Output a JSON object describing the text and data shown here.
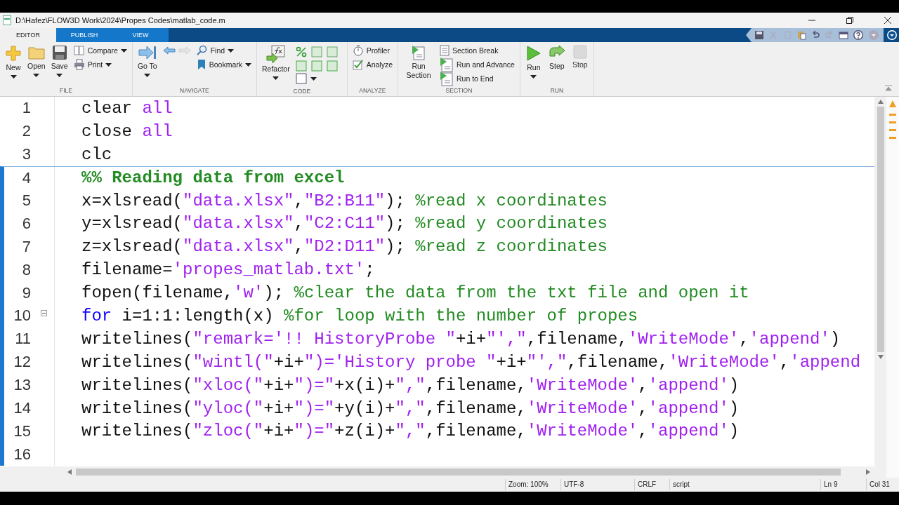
{
  "window": {
    "title": "D:\\Hafez\\FLOW3D Work\\2024\\Propes Codes\\matlab_code.m"
  },
  "tabs": [
    {
      "label": "EDITOR",
      "selected": true
    },
    {
      "label": "PUBLISH",
      "selected": false
    },
    {
      "label": "VIEW",
      "selected": false
    }
  ],
  "toolstrip": [
    {
      "label": "FILE",
      "big": [
        {
          "label": "New",
          "dropdown": true
        },
        {
          "label": "Open",
          "dropdown": true
        },
        {
          "label": "Save",
          "dropdown": true
        }
      ],
      "small": [
        {
          "label": "Compare",
          "dropdown": true
        },
        {
          "label": "Print",
          "dropdown": true
        }
      ]
    },
    {
      "label": "NAVIGATE",
      "big": [
        {
          "label": "Go To",
          "dropdown": true
        }
      ],
      "small": [
        {
          "label": "Find",
          "dropdown": true
        },
        {
          "label": "Bookmark",
          "dropdown": true
        }
      ]
    },
    {
      "label": "CODE",
      "big": [
        {
          "label": "Refactor",
          "dropdown": true
        }
      ]
    },
    {
      "label": "ANALYZE",
      "small": [
        {
          "label": "Profiler",
          "dropdown": false
        },
        {
          "label": "Analyze",
          "dropdown": false
        }
      ]
    },
    {
      "label": "SECTION",
      "big": [
        {
          "label": "Run Section",
          "dropdown": false
        }
      ],
      "small": [
        {
          "label": "Section Break",
          "dropdown": false
        },
        {
          "label": "Run and Advance",
          "dropdown": false
        },
        {
          "label": "Run to End",
          "dropdown": false
        }
      ]
    },
    {
      "label": "RUN",
      "big": [
        {
          "label": "Run",
          "dropdown": true,
          "disabled": false
        },
        {
          "label": "Step",
          "dropdown": false,
          "disabled": false
        },
        {
          "label": "Stop",
          "dropdown": false,
          "disabled": true
        }
      ]
    }
  ],
  "editor": {
    "lines": [
      {
        "number": "1",
        "section_start": false,
        "foldable": false,
        "segments": [
          {
            "kind": "plain",
            "text": "clear "
          },
          {
            "kind": "string",
            "text": "all"
          }
        ]
      },
      {
        "number": "2",
        "section_start": false,
        "foldable": false,
        "segments": [
          {
            "kind": "plain",
            "text": "close "
          },
          {
            "kind": "string",
            "text": "all"
          }
        ]
      },
      {
        "number": "3",
        "section_start": false,
        "foldable": false,
        "segments": [
          {
            "kind": "plain",
            "text": "clc"
          }
        ]
      },
      {
        "number": "4",
        "section_start": true,
        "foldable": false,
        "segments": [
          {
            "kind": "section",
            "text": "%% Reading data from excel"
          }
        ]
      },
      {
        "number": "5",
        "section_start": false,
        "foldable": false,
        "segments": [
          {
            "kind": "plain",
            "text": "x=xlsread("
          },
          {
            "kind": "string",
            "text": "\"data.xlsx\""
          },
          {
            "kind": "plain",
            "text": ","
          },
          {
            "kind": "string",
            "text": "\"B2:B11\""
          },
          {
            "kind": "plain",
            "text": "); "
          },
          {
            "kind": "comment",
            "text": "%read x coordinates"
          }
        ]
      },
      {
        "number": "6",
        "section_start": false,
        "foldable": false,
        "segments": [
          {
            "kind": "plain",
            "text": "y=xlsread("
          },
          {
            "kind": "string",
            "text": "\"data.xlsx\""
          },
          {
            "kind": "plain",
            "text": ","
          },
          {
            "kind": "string",
            "text": "\"C2:C11\""
          },
          {
            "kind": "plain",
            "text": "); "
          },
          {
            "kind": "comment",
            "text": "%read y coordinates"
          }
        ]
      },
      {
        "number": "7",
        "section_start": false,
        "foldable": false,
        "segments": [
          {
            "kind": "plain",
            "text": "z=xlsread("
          },
          {
            "kind": "string",
            "text": "\"data.xlsx\""
          },
          {
            "kind": "plain",
            "text": ","
          },
          {
            "kind": "string",
            "text": "\"D2:D11\""
          },
          {
            "kind": "plain",
            "text": "); "
          },
          {
            "kind": "comment",
            "text": "%read z coordinates"
          }
        ]
      },
      {
        "number": "8",
        "section_start": false,
        "foldable": false,
        "segments": [
          {
            "kind": "plain",
            "text": "filename="
          },
          {
            "kind": "string",
            "text": "'propes_matlab.txt'"
          },
          {
            "kind": "plain",
            "text": ";"
          }
        ]
      },
      {
        "number": "9",
        "section_start": false,
        "foldable": false,
        "segments": [
          {
            "kind": "plain",
            "text": "fopen(filename,"
          },
          {
            "kind": "string",
            "text": "'w'"
          },
          {
            "kind": "plain",
            "text": "); "
          },
          {
            "kind": "comment",
            "text": "%clear the data from the txt file and open it"
          }
        ]
      },
      {
        "number": "10",
        "section_start": false,
        "foldable": true,
        "segments": [
          {
            "kind": "keyword",
            "text": "for"
          },
          {
            "kind": "plain",
            "text": " i=1:1:length(x) "
          },
          {
            "kind": "comment",
            "text": "%for loop with the number of propes"
          }
        ]
      },
      {
        "number": "11",
        "section_start": false,
        "foldable": false,
        "segments": [
          {
            "kind": "plain",
            "text": "writelines("
          },
          {
            "kind": "string",
            "text": "\"remark='!! HistoryProbe \""
          },
          {
            "kind": "plain",
            "text": "+i+"
          },
          {
            "kind": "string",
            "text": "\"',\""
          },
          {
            "kind": "plain",
            "text": ",filename,"
          },
          {
            "kind": "string",
            "text": "'WriteMode'"
          },
          {
            "kind": "plain",
            "text": ","
          },
          {
            "kind": "string",
            "text": "'append'"
          },
          {
            "kind": "plain",
            "text": ")"
          }
        ]
      },
      {
        "number": "12",
        "section_start": false,
        "foldable": false,
        "segments": [
          {
            "kind": "plain",
            "text": "writelines("
          },
          {
            "kind": "string",
            "text": "\"wintl(\""
          },
          {
            "kind": "plain",
            "text": "+i+"
          },
          {
            "kind": "string",
            "text": "\")='History probe \""
          },
          {
            "kind": "plain",
            "text": "+i+"
          },
          {
            "kind": "string",
            "text": "\"',\""
          },
          {
            "kind": "plain",
            "text": ",filename,"
          },
          {
            "kind": "string",
            "text": "'WriteMode'"
          },
          {
            "kind": "plain",
            "text": ","
          },
          {
            "kind": "string",
            "text": "'append"
          }
        ]
      },
      {
        "number": "13",
        "section_start": false,
        "foldable": false,
        "segments": [
          {
            "kind": "plain",
            "text": "writelines("
          },
          {
            "kind": "string",
            "text": "\"xloc(\""
          },
          {
            "kind": "plain",
            "text": "+i+"
          },
          {
            "kind": "string",
            "text": "\")=\""
          },
          {
            "kind": "plain",
            "text": "+x(i)+"
          },
          {
            "kind": "string",
            "text": "\",\""
          },
          {
            "kind": "plain",
            "text": ",filename,"
          },
          {
            "kind": "string",
            "text": "'WriteMode'"
          },
          {
            "kind": "plain",
            "text": ","
          },
          {
            "kind": "string",
            "text": "'append'"
          },
          {
            "kind": "plain",
            "text": ")"
          }
        ]
      },
      {
        "number": "14",
        "section_start": false,
        "foldable": false,
        "segments": [
          {
            "kind": "plain",
            "text": "writelines("
          },
          {
            "kind": "string",
            "text": "\"yloc(\""
          },
          {
            "kind": "plain",
            "text": "+i+"
          },
          {
            "kind": "string",
            "text": "\")=\""
          },
          {
            "kind": "plain",
            "text": "+y(i)+"
          },
          {
            "kind": "string",
            "text": "\",\""
          },
          {
            "kind": "plain",
            "text": ",filename,"
          },
          {
            "kind": "string",
            "text": "'WriteMode'"
          },
          {
            "kind": "plain",
            "text": ","
          },
          {
            "kind": "string",
            "text": "'append'"
          },
          {
            "kind": "plain",
            "text": ")"
          }
        ]
      },
      {
        "number": "15",
        "section_start": false,
        "foldable": false,
        "segments": [
          {
            "kind": "plain",
            "text": "writelines("
          },
          {
            "kind": "string",
            "text": "\"zloc(\""
          },
          {
            "kind": "plain",
            "text": "+i+"
          },
          {
            "kind": "string",
            "text": "\")=\""
          },
          {
            "kind": "plain",
            "text": "+z(i)+"
          },
          {
            "kind": "string",
            "text": "\",\""
          },
          {
            "kind": "plain",
            "text": ",filename,"
          },
          {
            "kind": "string",
            "text": "'WriteMode'"
          },
          {
            "kind": "plain",
            "text": ","
          },
          {
            "kind": "string",
            "text": "'append'"
          },
          {
            "kind": "plain",
            "text": ")"
          }
        ]
      },
      {
        "number": "16",
        "section_start": false,
        "foldable": false
      }
    ]
  },
  "status_bar": {
    "zoom": "Zoom: 100%",
    "encoding": "UTF-8",
    "line_ending": "CRLF",
    "type": "script",
    "line": "Ln  9",
    "column": "Col  31"
  }
}
